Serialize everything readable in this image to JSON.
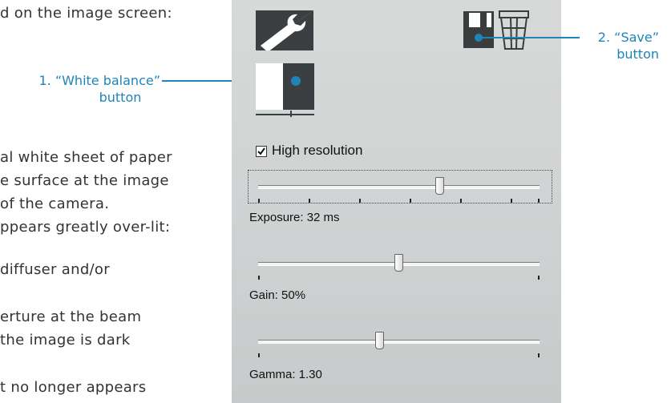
{
  "doc": {
    "lines": [
      "d on the image screen:",
      "al white sheet of paper",
      "e surface at the image",
      " of the camera.",
      "ppears greatly over-lit:",
      "diffuser and/or",
      "erture at the beam",
      "the image is dark",
      "t no longer appears"
    ]
  },
  "callouts": {
    "white_balance": {
      "line1": "1. “White balance”",
      "line2": "button"
    },
    "save": {
      "line1": "2. “Save”",
      "line2": "button"
    }
  },
  "panel": {
    "icons": {
      "settings": "wrench-icon",
      "white_balance": "white-balance-icon",
      "save": "floppy-disk-icon",
      "grid": "grid-icon"
    },
    "high_resolution": {
      "label": "High resolution",
      "checked": true
    },
    "exposure": {
      "label": "Exposure: 32 ms",
      "value_fraction": 0.65
    },
    "gain": {
      "label": "Gain: 50%",
      "value_fraction": 0.5
    },
    "gamma": {
      "label": "Gamma: 1.30",
      "value_fraction": 0.43
    }
  },
  "colors": {
    "callout": "#1f84b8",
    "icon": "#3a3d3e",
    "panel_bg": "#d2d4d4"
  }
}
